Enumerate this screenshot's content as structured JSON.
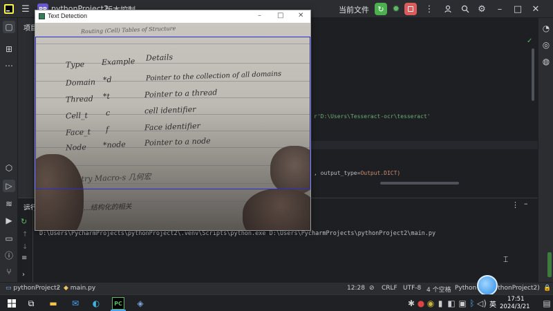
{
  "ide": {
    "project_name": "pythonProject2",
    "project_badge": "PP",
    "vcs_label": "版本控制",
    "run_config": "当前文件",
    "project_panel_label": "项目",
    "run_panel_label": "运行"
  },
  "editor": {
    "code_path_line": "r'D:\\Users\\Tesseract-ocr\\tesseract'",
    "code_output_line_pre": ", output_type=",
    "code_output_line_post": "Output.DICT)"
  },
  "console": {
    "command": "D:\\Users\\PycharmProjects\\pythonProject2\\.venv\\Scripts\\python.exe D:\\Users\\PycharmProjects\\pythonProject2\\main.py"
  },
  "status_bar": {
    "breadcrumb_project": "pythonProject2",
    "breadcrumb_file": "main.py",
    "position": "12:28",
    "line_ending": "CRLF",
    "encoding": "UTF-8",
    "indent": "4 个空格",
    "interpreter": "Python 3.1  pythonProject2)"
  },
  "taskbar": {
    "ime": "英",
    "time": "17:51",
    "date": "2024/3/21"
  },
  "detection_window": {
    "title": "Text Detection",
    "handwriting": {
      "header": "Routing (Cell) Tables of Structure",
      "col_type": "Type",
      "col_example": "Example",
      "col_details": "Details",
      "row1_type": "Domain",
      "row1_ex": "*d",
      "row1_detail": "Pointer to the collection of all domains",
      "row2_type": "Thread",
      "row2_ex": "*t",
      "row2_detail": "Pointer to a thread",
      "row3_type": "Cell_t",
      "row3_ex": "c",
      "row3_detail": "cell identifier",
      "row4_type": "Face_t",
      "row4_ex": "f",
      "row4_detail": "Face identifier",
      "row5_type": "Node",
      "row5_ex": "*node",
      "row5_detail": "Pointer to a node",
      "bottom_line": "...try Macro-s  几何宏",
      "bottom_line2": "...结构化的相关"
    }
  },
  "colors": {
    "ide_bg": "#1e1f22",
    "panel_bg": "#2b2d30",
    "run_green": "#4caf50",
    "stop_red": "#db5c5c",
    "roi_blue": "#2b2bd6"
  }
}
